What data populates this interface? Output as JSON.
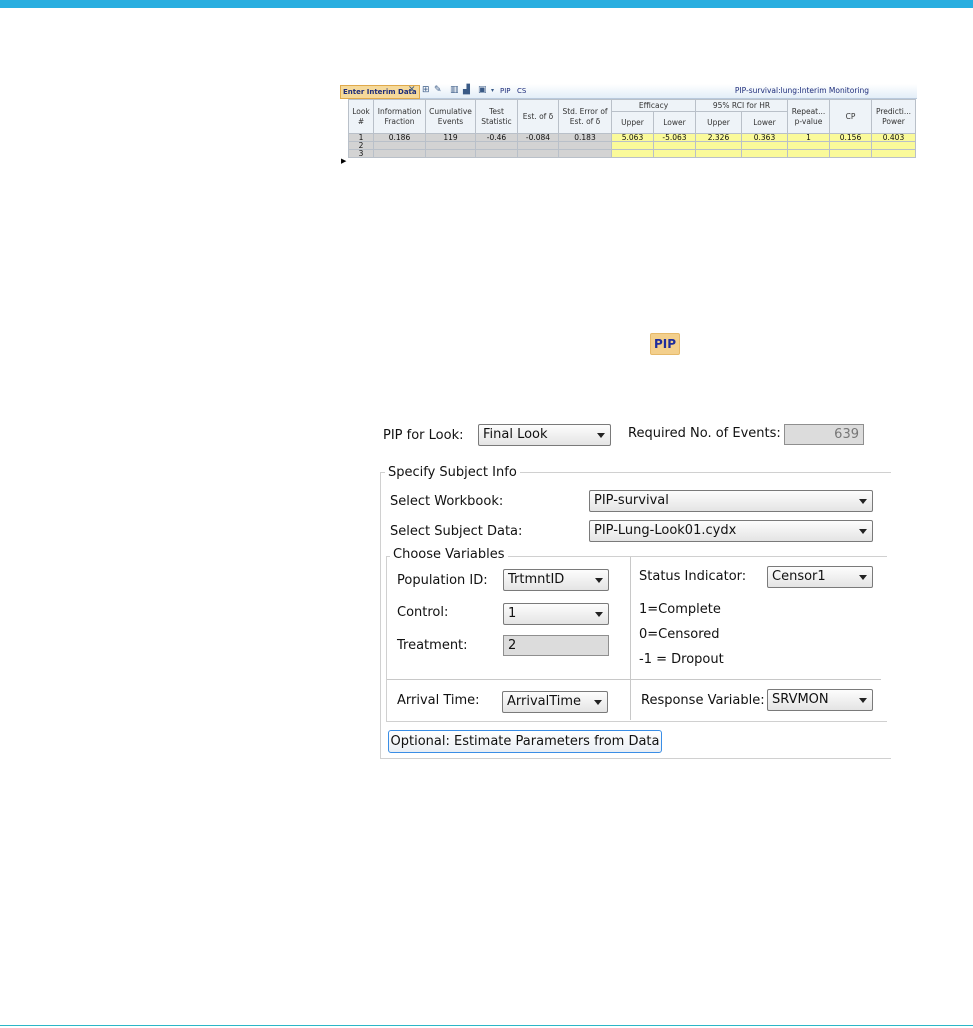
{
  "interim": {
    "toolbar": {
      "enter_label": "Enter Interim Data",
      "pip_label": "PIP",
      "cs_label": "CS",
      "title": "PIP-survival:lung:Interim Monitoring"
    },
    "headers": {
      "look": "Look #",
      "info_fraction": "Information Fraction",
      "cum_events": "Cumulative Events",
      "test_stat": "Test Statistic",
      "est_delta": "Est. of δ",
      "se_delta": "Std. Error of Est. of δ",
      "efficacy": "Efficacy",
      "rci": "95% RCI for HR",
      "repeat_p": "Repeat... p-value",
      "cp": "CP",
      "pred_power": "Predicti... Power",
      "upper": "Upper",
      "lower": "Lower"
    },
    "rows": [
      {
        "look": "1",
        "info_fraction": "0.186",
        "cum_events": "119",
        "test_stat": "-0.46",
        "est_delta": "-0.084",
        "se_delta": "0.183",
        "eff_upper": "5.063",
        "eff_lower": "-5.063",
        "rci_upper": "2.326",
        "rci_lower": "0.363",
        "repeat_p": "1",
        "cp": "0.156",
        "pred_power": "0.403"
      },
      {
        "look": "2"
      },
      {
        "look": "3"
      }
    ]
  },
  "pip_button": "PIP",
  "dialog": {
    "pip_for_look_label": "PIP for Look:",
    "pip_for_look_value": "Final Look",
    "required_events_label": "Required No. of Events:",
    "required_events_value": "639",
    "subject_info_title": "Specify Subject Info",
    "workbook_label": "Select Workbook:",
    "workbook_value": "PIP-survival",
    "subject_data_label": "Select Subject Data:",
    "subject_data_value": "PIP-Lung-Look01.cydx",
    "choose_vars_title": "Choose Variables",
    "population_id_label": "Population ID:",
    "population_id_value": "TrtmntID",
    "control_label": "Control:",
    "control_value": "1",
    "treatment_label": "Treatment:",
    "treatment_value": "2",
    "status_label": "Status Indicator:",
    "status_value": "Censor1",
    "status_note_1": "1=Complete",
    "status_note_2": "0=Censored",
    "status_note_3": "-1 = Dropout",
    "arrival_label": "Arrival Time:",
    "arrival_value": "ArrivalTime",
    "response_label": "Response Variable:",
    "response_value": "SRVMON",
    "optional_button": "Optional: Estimate Parameters from Data"
  }
}
